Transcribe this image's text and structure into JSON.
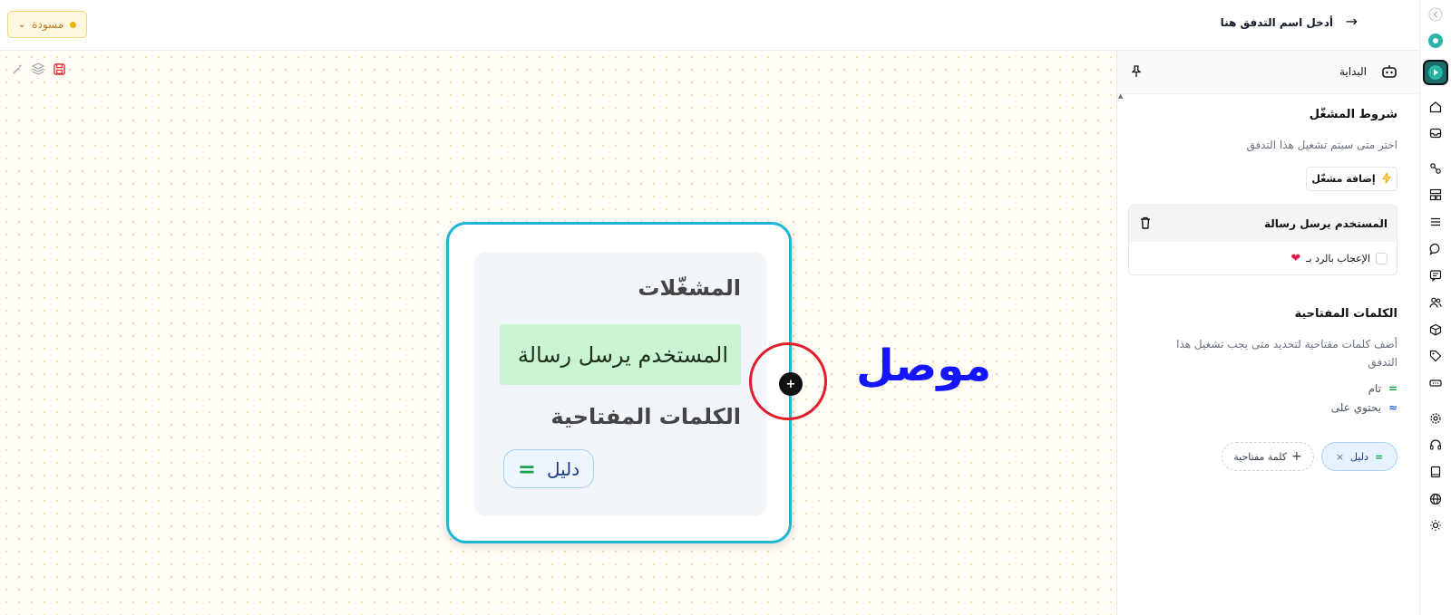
{
  "header": {
    "flow_name_placeholder": "أدخل اسم التدفق هنا",
    "status_label": "مسودة"
  },
  "node": {
    "triggers_title": "المشغّلات",
    "trigger_item": "المستخدم يرسل رسالة",
    "keywords_title": "الكلمات المفتاحية",
    "keyword_chip": "دليل"
  },
  "annotation": {
    "connector_label": "موصل"
  },
  "panel": {
    "header_title": "البداية",
    "trigger_conditions_title": "شروط المشغّل",
    "trigger_conditions_desc": "اختر متى سيتم تشغيل هذا التدفق",
    "add_trigger_label": "إضافة مشغّل",
    "trigger_card_title": "المستخدم يرسل رسالة",
    "like_reply_label": "الإعجاب بالرد بـ",
    "keywords_title": "الكلمات المفتاحية",
    "keywords_desc": "أضف كلمات مفتاحية لتحديد متى يجب تشغيل هذا التدفق",
    "match_exact_label": "تام",
    "match_contains_label": "يحتوي على",
    "keyword_chip": "دليل",
    "add_keyword_label": "كلمة مفتاحية"
  },
  "colors": {
    "accent": "#1fb5d6",
    "trigger_bg": "#c9f5d2",
    "highlight_ring": "#e11d2a",
    "annotation_text": "#1515ff",
    "draft_badge": "#eab308"
  }
}
